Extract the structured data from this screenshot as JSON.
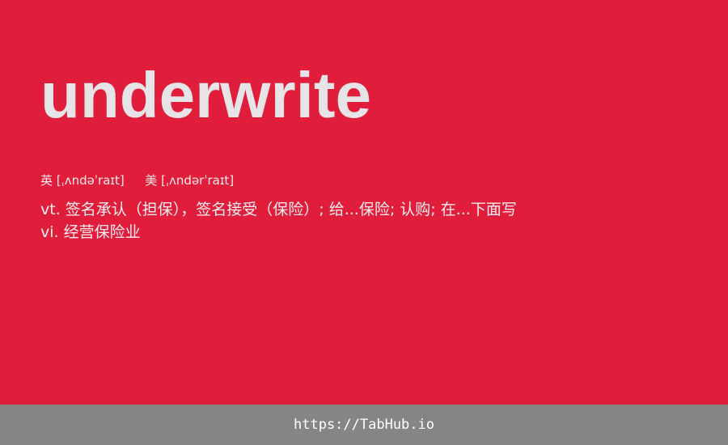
{
  "word": "underwrite",
  "phonetics": {
    "uk_label": "英",
    "uk_ipa": "[ˌʌndəˈraɪt]",
    "us_label": "美",
    "us_ipa": "[ˌʌndərˈraɪt]"
  },
  "definitions": [
    "vt. 签名承认（担保），签名接受（保险）; 给...保险; 认购; 在...下面写",
    "vi. 经营保险业"
  ],
  "footer": {
    "link_text": "https://TabHub.io"
  },
  "colors": {
    "background": "#e01e3c",
    "word": "#e6e4e6",
    "footer_bar": "#858585"
  }
}
